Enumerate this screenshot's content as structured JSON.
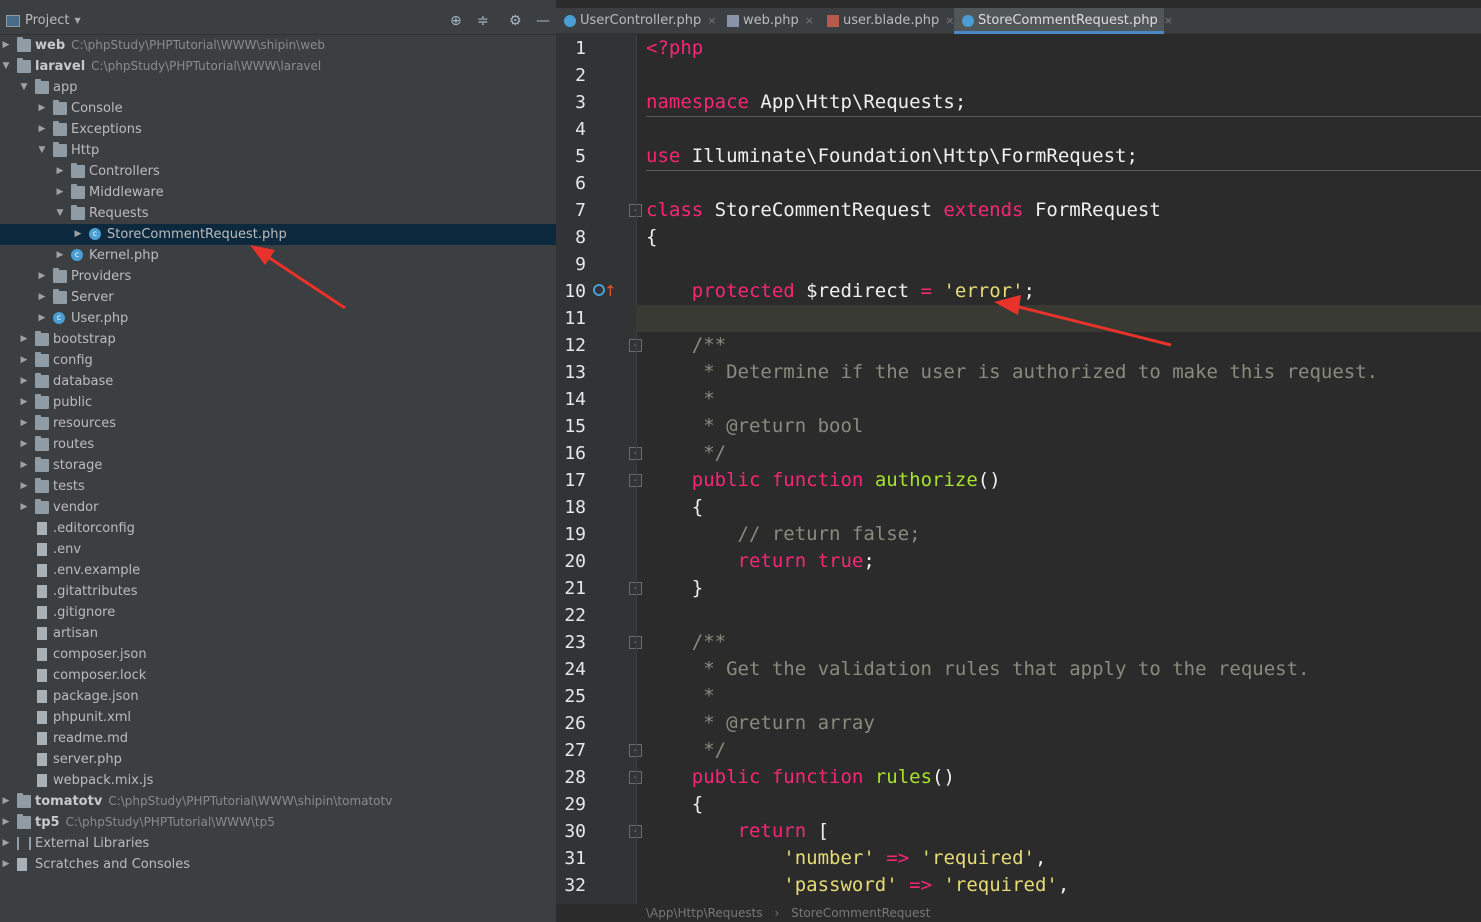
{
  "project_panel": {
    "title": "Project",
    "tree": [
      {
        "name": "web",
        "path": "C:\\phpStudy\\PHPTutorial\\WWW\\shipin\\web",
        "kind": "module",
        "level": 0,
        "expanded": false
      },
      {
        "name": "laravel",
        "path": "C:\\phpStudy\\PHPTutorial\\WWW\\laravel",
        "kind": "module",
        "level": 0,
        "expanded": true
      },
      {
        "name": "app",
        "kind": "folder",
        "level": 1,
        "expanded": true
      },
      {
        "name": "Console",
        "kind": "folder",
        "level": 2,
        "expanded": false
      },
      {
        "name": "Exceptions",
        "kind": "folder",
        "level": 2,
        "expanded": false
      },
      {
        "name": "Http",
        "kind": "folder",
        "level": 2,
        "expanded": true
      },
      {
        "name": "Controllers",
        "kind": "folder",
        "level": 3,
        "expanded": false
      },
      {
        "name": "Middleware",
        "kind": "folder",
        "level": 3,
        "expanded": false
      },
      {
        "name": "Requests",
        "kind": "folder",
        "level": 3,
        "expanded": true
      },
      {
        "name": "StoreCommentRequest.php",
        "kind": "class",
        "level": 4,
        "expanded": false,
        "selected": true
      },
      {
        "name": "Kernel.php",
        "kind": "class",
        "level": 3,
        "expanded": false
      },
      {
        "name": "Providers",
        "kind": "folder",
        "level": 2,
        "expanded": false
      },
      {
        "name": "Server",
        "kind": "folder",
        "level": 2,
        "expanded": false
      },
      {
        "name": "User.php",
        "kind": "class",
        "level": 2,
        "expanded": false
      },
      {
        "name": "bootstrap",
        "kind": "folder",
        "level": 1,
        "expanded": false
      },
      {
        "name": "config",
        "kind": "folder",
        "level": 1,
        "expanded": false
      },
      {
        "name": "database",
        "kind": "folder",
        "level": 1,
        "expanded": false
      },
      {
        "name": "public",
        "kind": "folder",
        "level": 1,
        "expanded": false
      },
      {
        "name": "resources",
        "kind": "folder",
        "level": 1,
        "expanded": false
      },
      {
        "name": "routes",
        "kind": "folder",
        "level": 1,
        "expanded": false
      },
      {
        "name": "storage",
        "kind": "folder",
        "level": 1,
        "expanded": false
      },
      {
        "name": "tests",
        "kind": "folder",
        "level": 1,
        "expanded": false
      },
      {
        "name": "vendor",
        "kind": "folder",
        "level": 1,
        "expanded": false
      },
      {
        "name": ".editorconfig",
        "kind": "file",
        "level": 1
      },
      {
        "name": ".env",
        "kind": "file",
        "level": 1
      },
      {
        "name": ".env.example",
        "kind": "file",
        "level": 1
      },
      {
        "name": ".gitattributes",
        "kind": "file",
        "level": 1
      },
      {
        "name": ".gitignore",
        "kind": "file",
        "level": 1
      },
      {
        "name": "artisan",
        "kind": "file",
        "level": 1
      },
      {
        "name": "composer.json",
        "kind": "file",
        "level": 1
      },
      {
        "name": "composer.lock",
        "kind": "file",
        "level": 1
      },
      {
        "name": "package.json",
        "kind": "file",
        "level": 1
      },
      {
        "name": "phpunit.xml",
        "kind": "file",
        "level": 1
      },
      {
        "name": "readme.md",
        "kind": "file",
        "level": 1
      },
      {
        "name": "server.php",
        "kind": "file",
        "level": 1
      },
      {
        "name": "webpack.mix.js",
        "kind": "file",
        "level": 1
      },
      {
        "name": "tomatotv",
        "path": "C:\\phpStudy\\PHPTutorial\\WWW\\shipin\\tomatotv",
        "kind": "module",
        "level": 0,
        "expanded": false
      },
      {
        "name": "tp5",
        "path": "C:\\phpStudy\\PHPTutorial\\WWW\\tp5",
        "kind": "module",
        "level": 0,
        "expanded": false
      },
      {
        "name": "External Libraries",
        "kind": "library",
        "level": 0,
        "expanded": false
      },
      {
        "name": "Scratches and Consoles",
        "kind": "scratch",
        "level": 0,
        "expanded": false
      }
    ]
  },
  "tabs": [
    {
      "label": "UserController.php",
      "icon": "php-class-icon",
      "active": false
    },
    {
      "label": "web.php",
      "icon": "php-file-icon",
      "active": false
    },
    {
      "label": "user.blade.php",
      "icon": "blade-file-icon",
      "active": false
    },
    {
      "label": "StoreCommentRequest.php",
      "icon": "php-class-icon",
      "active": true
    }
  ],
  "editor": {
    "current_line": 11,
    "lines": [
      [
        [
          "kw",
          "<?php"
        ]
      ],
      [],
      [
        [
          "kw",
          "namespace"
        ],
        [
          "plain",
          " App\\Http\\Requests;"
        ]
      ],
      [],
      [
        [
          "kw",
          "use"
        ],
        [
          "plain",
          " Illuminate\\Foundation\\Http\\FormRequest;"
        ]
      ],
      [],
      [
        [
          "kw",
          "class"
        ],
        [
          "plain",
          " StoreCommentRequest "
        ],
        [
          "kw",
          "extends"
        ],
        [
          "plain",
          " FormRequest"
        ]
      ],
      [
        [
          "plain",
          "{"
        ]
      ],
      [],
      [
        [
          "plain",
          "    "
        ],
        [
          "kw",
          "protected"
        ],
        [
          "plain",
          " $redirect "
        ],
        [
          "kw",
          "="
        ],
        [
          "plain",
          " "
        ],
        [
          "str",
          "'error'"
        ],
        [
          "plain",
          ";"
        ]
      ],
      [],
      [
        [
          "cm",
          "    /**"
        ]
      ],
      [
        [
          "cm",
          "     * Determine if the user is authorized to make this request."
        ]
      ],
      [
        [
          "cm",
          "     *"
        ]
      ],
      [
        [
          "cm",
          "     * @return bool"
        ]
      ],
      [
        [
          "cm",
          "     */"
        ]
      ],
      [
        [
          "plain",
          "    "
        ],
        [
          "kw",
          "public function"
        ],
        [
          "plain",
          " "
        ],
        [
          "fn",
          "authorize"
        ],
        [
          "plain",
          "()"
        ]
      ],
      [
        [
          "plain",
          "    {"
        ]
      ],
      [
        [
          "cm",
          "        // return false;"
        ]
      ],
      [
        [
          "plain",
          "        "
        ],
        [
          "kw",
          "return true"
        ],
        [
          "plain",
          ";"
        ]
      ],
      [
        [
          "plain",
          "    }"
        ]
      ],
      [],
      [
        [
          "cm",
          "    /**"
        ]
      ],
      [
        [
          "cm",
          "     * Get the validation rules that apply to the request."
        ]
      ],
      [
        [
          "cm",
          "     *"
        ]
      ],
      [
        [
          "cm",
          "     * @return array"
        ]
      ],
      [
        [
          "cm",
          "     */"
        ]
      ],
      [
        [
          "plain",
          "    "
        ],
        [
          "kw",
          "public function"
        ],
        [
          "plain",
          " "
        ],
        [
          "fn",
          "rules"
        ],
        [
          "plain",
          "()"
        ]
      ],
      [
        [
          "plain",
          "    {"
        ]
      ],
      [
        [
          "plain",
          "        "
        ],
        [
          "kw",
          "return"
        ],
        [
          "plain",
          " ["
        ]
      ],
      [
        [
          "plain",
          "            "
        ],
        [
          "str",
          "'number'"
        ],
        [
          "plain",
          " "
        ],
        [
          "kw",
          "=>"
        ],
        [
          "plain",
          " "
        ],
        [
          "str",
          "'required'"
        ],
        [
          "plain",
          ","
        ]
      ],
      [
        [
          "plain",
          "            "
        ],
        [
          "str",
          "'password'"
        ],
        [
          "plain",
          " "
        ],
        [
          "kw",
          "=>"
        ],
        [
          "plain",
          " "
        ],
        [
          "str",
          "'required'"
        ],
        [
          "plain",
          ","
        ]
      ]
    ],
    "fold_markers": [
      7,
      12,
      16,
      17,
      21,
      23,
      27,
      28,
      30
    ],
    "line_10_markers": "override-icon"
  },
  "breadcrumb": [
    "\\App\\Http\\Requests",
    "StoreCommentRequest"
  ],
  "colors": {
    "keyword": "#f92672",
    "string": "#e6db74",
    "comment": "#8a8a7e",
    "function": "#a6e22e",
    "annotation_arrow": "#e8322a",
    "selection": "#0d293e"
  }
}
